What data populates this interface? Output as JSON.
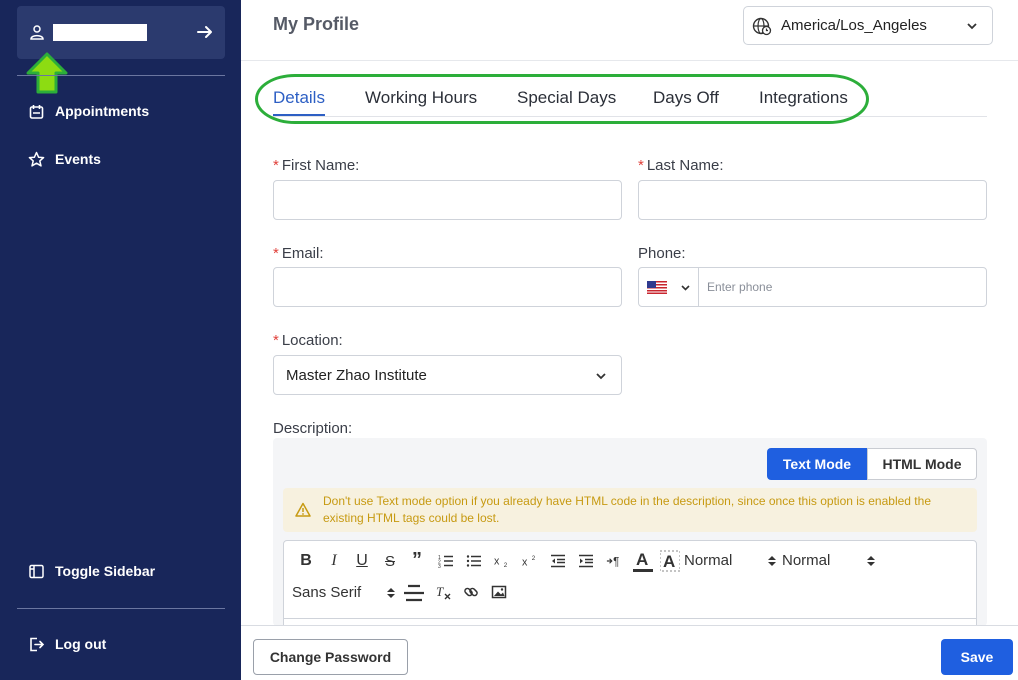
{
  "sidebar": {
    "nav": [
      {
        "label": "Appointments",
        "icon": "calendar-icon"
      },
      {
        "label": "Events",
        "icon": "star-icon"
      }
    ],
    "toggle_label": "Toggle Sidebar",
    "logout_label": "Log out",
    "colors": {
      "background": "#18265a",
      "user_box": "#2b3a6e"
    }
  },
  "header": {
    "title": "My Profile",
    "timezone": "America/Los_Angeles"
  },
  "tabs": [
    {
      "label": "Details",
      "active": true
    },
    {
      "label": "Working Hours",
      "active": false
    },
    {
      "label": "Special Days",
      "active": false
    },
    {
      "label": "Days Off",
      "active": false
    },
    {
      "label": "Integrations",
      "active": false
    }
  ],
  "form": {
    "first_name": {
      "label": "First Name:",
      "required": true,
      "value": ""
    },
    "last_name": {
      "label": "Last Name:",
      "required": true,
      "value": ""
    },
    "email": {
      "label": "Email:",
      "required": true,
      "value": ""
    },
    "phone": {
      "label": "Phone:",
      "placeholder": "Enter phone",
      "country": "US"
    },
    "location": {
      "label": "Location:",
      "required": true,
      "value": "Master Zhao Institute"
    },
    "description": {
      "label": "Description:"
    }
  },
  "editor": {
    "mode_text": "Text Mode",
    "mode_html": "HTML Mode",
    "active_mode": "Text Mode",
    "warning": "Don't use Text mode option if you already have HTML code in the description, since once this option is enabled the existing HTML tags could be lost.",
    "toolbar": {
      "heading_select": "Normal",
      "size_select": "Normal",
      "font_select": "Sans Serif"
    }
  },
  "footer": {
    "change_password": "Change Password",
    "save": "Save"
  },
  "colors": {
    "accent": "#1f5fe0",
    "active_tab": "#2d5fc4",
    "annotation": "#2cae3a",
    "warning_bg": "#f7f1df",
    "warning_text": "#c79a12",
    "required": "#e0403a"
  }
}
